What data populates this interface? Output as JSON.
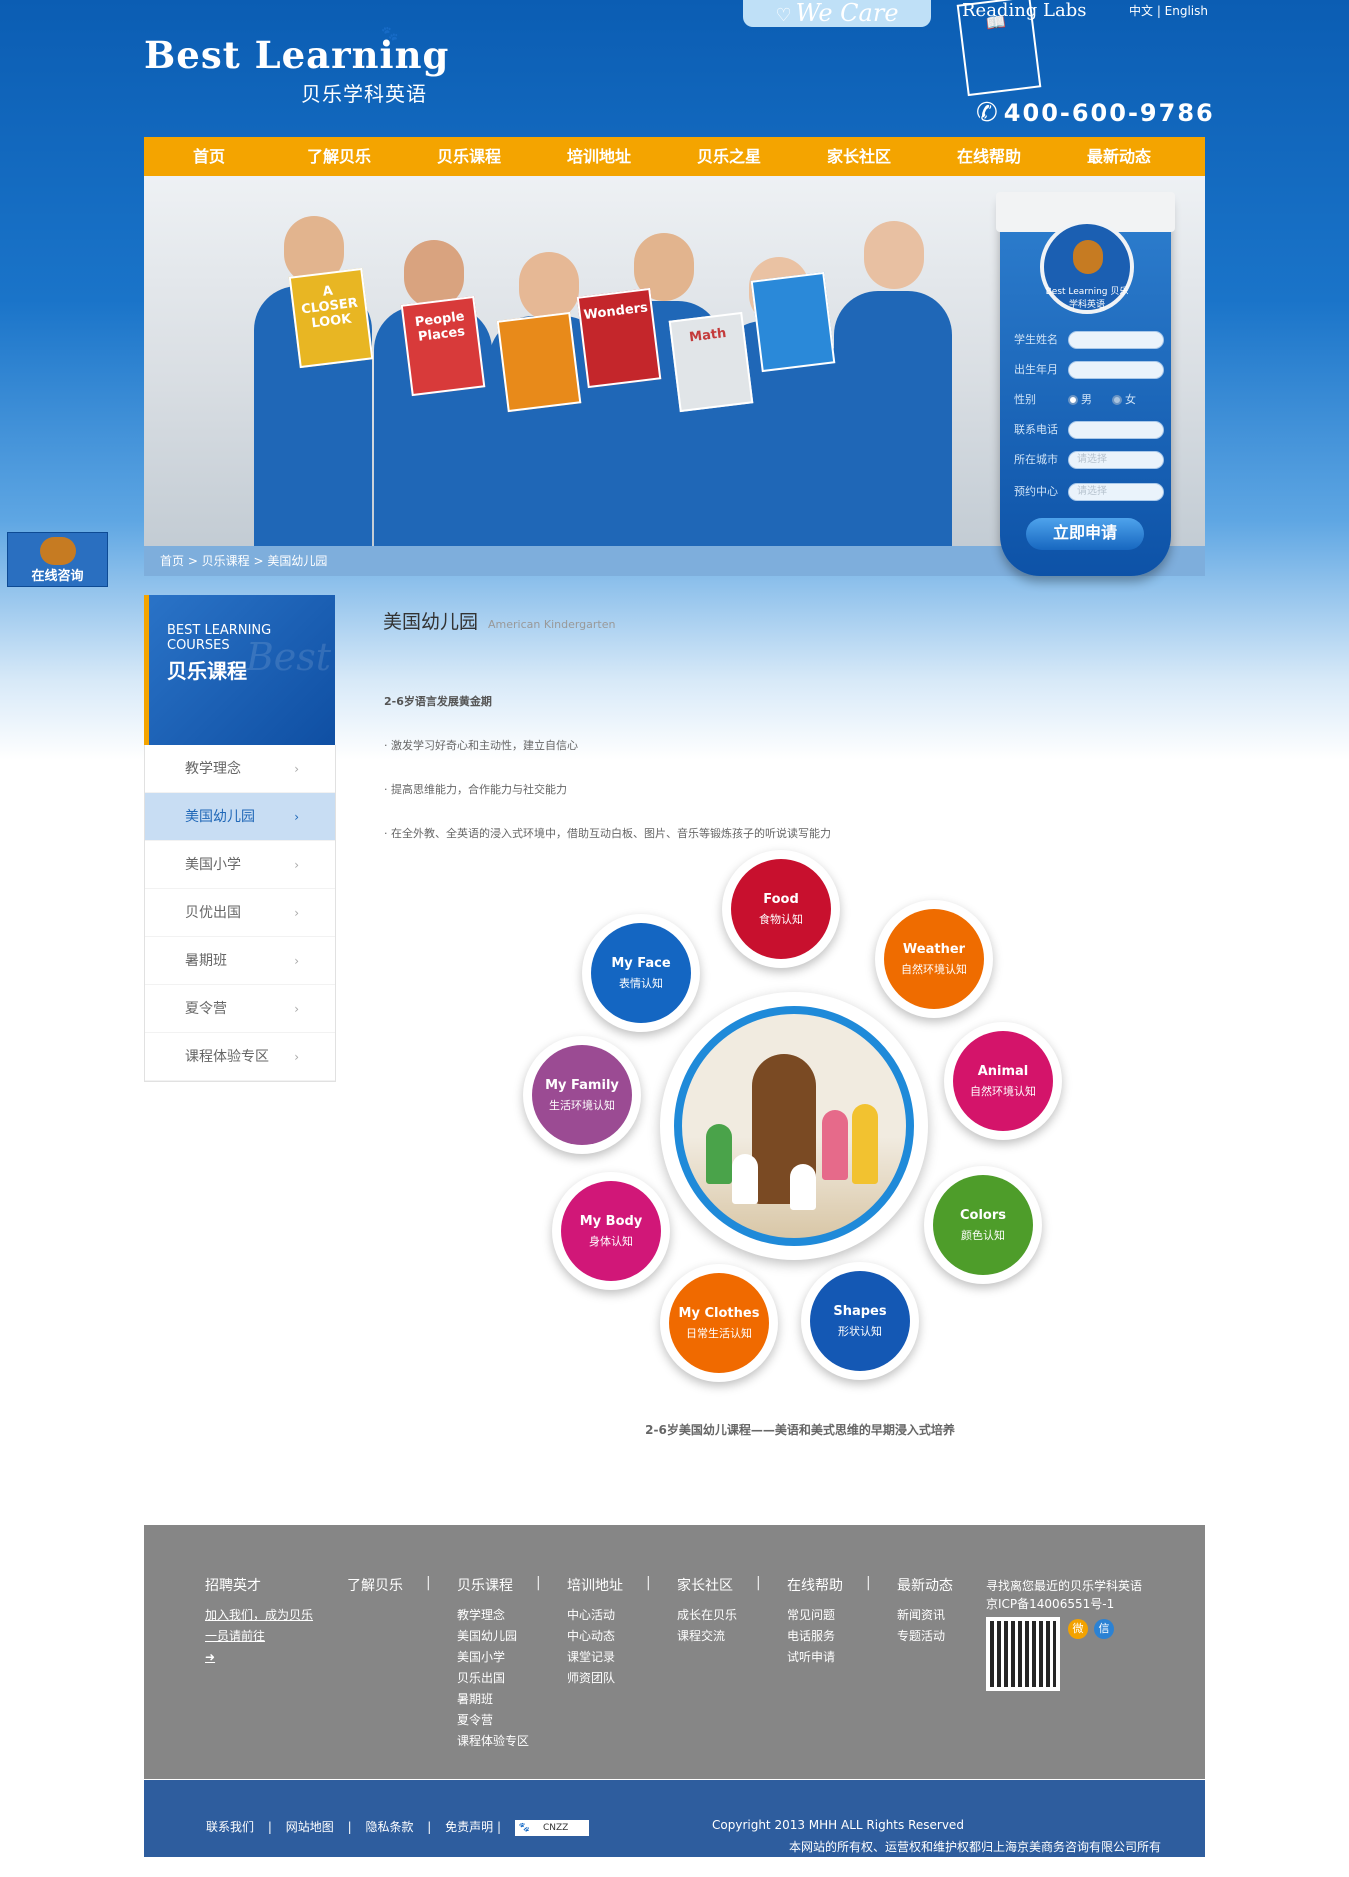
{
  "header": {
    "wecare": "We Care",
    "reading_labs": "Reading Labs",
    "lang": "中文 | English",
    "logo_en": "Best Learning",
    "logo_cn": "贝乐学科英语",
    "phone": "400-600-9786"
  },
  "nav": [
    "首页",
    "了解贝乐",
    "贝乐课程",
    "培训地址",
    "贝乐之星",
    "家长社区",
    "在线帮助",
    "最新动态"
  ],
  "banner": {
    "book_titles": [
      "A CLOSER LOOK",
      "People Places",
      "",
      "Wonders",
      "Math",
      ""
    ],
    "breadcrumb": "首页 > 贝乐课程 > 美国幼儿园"
  },
  "form": {
    "emblem": "Best Learning 贝乐学科英语",
    "name_label": "学生姓名",
    "birth_label": "出生年月",
    "gender_label": "性别",
    "male": "男",
    "female": "女",
    "phone_label": "联系电话",
    "city_label": "所在城市",
    "city_placeholder": "请选择",
    "center_label": "预约中心",
    "center_placeholder": "请选择",
    "submit": "立即申请"
  },
  "consult": "在线咨询",
  "sidebar": {
    "en": "BEST LEARNING COURSES",
    "cn": "贝乐课程",
    "watermark": "Best",
    "items": [
      {
        "label": "教学理念",
        "active": false
      },
      {
        "label": "美国幼儿园",
        "active": true
      },
      {
        "label": "美国小学",
        "active": false
      },
      {
        "label": "贝优出国",
        "active": false
      },
      {
        "label": "暑期班",
        "active": false
      },
      {
        "label": "夏令营",
        "active": false
      },
      {
        "label": "课程体验专区",
        "active": false
      }
    ],
    "arrow": "›"
  },
  "content": {
    "title": "美国幼儿园",
    "subtitle": "American Kindergarten",
    "lines": [
      "2-6岁语言发展黄金期",
      "· 激发学习好奇心和主动性，建立自信心",
      "· 提高思维能力，合作能力与社交能力",
      "· 在全外教、全英语的浸入式环境中，借助互动白板、图片、音乐等锻炼孩子的听说读写能力"
    ],
    "bubbles": [
      {
        "en": "Food",
        "cn": "食物认知",
        "color": "#c8102e"
      },
      {
        "en": "My Face",
        "cn": "表情认知",
        "color": "#1466c2"
      },
      {
        "en": "Weather",
        "cn": "自然环境认知",
        "color": "#ef6c00"
      },
      {
        "en": "My Family",
        "cn": "生活环境认知",
        "color": "#9b4b93"
      },
      {
        "en": "Animal",
        "cn": "自然环境认知",
        "color": "#d4146a"
      },
      {
        "en": "My Body",
        "cn": "身体认知",
        "color": "#d11778"
      },
      {
        "en": "Colors",
        "cn": "颜色认知",
        "color": "#4e9d2a"
      },
      {
        "en": "My Clothes",
        "cn": "日常生活认知",
        "color": "#f06a00"
      },
      {
        "en": "Shapes",
        "cn": "形状认知",
        "color": "#1458b4"
      }
    ],
    "caption": "2-6岁美国幼儿课程——美语和美式思维的早期浸入式培养"
  },
  "footer": {
    "recruit": {
      "title": "招聘英才",
      "links": [
        "加入我们，成为贝乐",
        "一员请前往"
      ]
    },
    "cols": [
      {
        "title": "了解贝乐",
        "links": []
      },
      {
        "title": "贝乐课程",
        "links": [
          "教学理念",
          "美国幼儿园",
          "美国小学",
          "贝乐出国",
          "暑期班",
          "夏令营",
          "课程体验专区"
        ]
      },
      {
        "title": "培训地址",
        "links": [
          "中心活动",
          "中心动态",
          "课堂记录",
          "师资团队"
        ]
      },
      {
        "title": "家长社区",
        "links": [
          "成长在贝乐",
          "课程交流"
        ]
      },
      {
        "title": "在线帮助",
        "links": [
          "常见问题",
          "电话服务",
          "试听申请"
        ]
      },
      {
        "title": "最新动态",
        "links": [
          "新闻资讯",
          "专题活动"
        ]
      }
    ],
    "find": "寻找离您最近的贝乐学科英语",
    "icp": "京ICP备14006551号-1",
    "social": [
      {
        "name": "weibo",
        "color": "#f3a200"
      },
      {
        "name": "wechat",
        "color": "#2b82d4"
      }
    ]
  },
  "bottom": {
    "links": [
      "联系我们",
      "|",
      "网站地图",
      "|",
      "隐私条款",
      "|",
      "免责声明 |"
    ],
    "badge": "CNZZ",
    "copyright": "Copyright 2013 MHH ALL Rights Reserved",
    "owner": "本网站的所有权、运营权和维护权都归上海京美商务咨询有限公司所有"
  }
}
